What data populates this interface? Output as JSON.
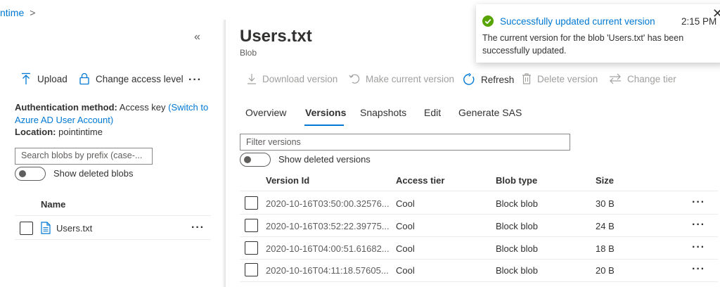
{
  "breadcrumb": {
    "text": "ntime",
    "separator": ">"
  },
  "left": {
    "collapse_glyph": "«",
    "upload_label": "Upload",
    "change_access_label": "Change access level",
    "more_glyph": "···",
    "auth_method_label": "Authentication method:",
    "auth_method_value": "Access key",
    "auth_switch_link": "(Switch to Azure AD User Account)",
    "location_label": "Location:",
    "location_value": "pointintime",
    "search_placeholder": "Search blobs by prefix (case-...",
    "show_deleted_label": "Show deleted blobs",
    "name_header": "Name",
    "files": [
      {
        "name": "Users.txt"
      }
    ]
  },
  "blob": {
    "title": "Users.txt",
    "subtitle": "Blob"
  },
  "toolbar": {
    "download": "Download version",
    "make_current": "Make current version",
    "refresh": "Refresh",
    "delete": "Delete version",
    "change_tier": "Change tier"
  },
  "tabs": [
    "Overview",
    "Versions",
    "Snapshots",
    "Edit",
    "Generate SAS"
  ],
  "active_tab": "Versions",
  "filter_placeholder": "Filter versions",
  "show_deleted_versions_label": "Show deleted versions",
  "table": {
    "headers": [
      "Version Id",
      "Access tier",
      "Blob type",
      "Size"
    ],
    "rows": [
      {
        "id": "2020-10-16T03:50:00.32576...",
        "tier": "Cool",
        "type": "Block blob",
        "size": "30 B"
      },
      {
        "id": "2020-10-16T03:52:22.39775...",
        "tier": "Cool",
        "type": "Block blob",
        "size": "24 B"
      },
      {
        "id": "2020-10-16T04:00:51.61682...",
        "tier": "Cool",
        "type": "Block blob",
        "size": "18 B"
      },
      {
        "id": "2020-10-16T04:11:18.57605...",
        "tier": "Cool",
        "type": "Block blob",
        "size": "20 B"
      }
    ]
  },
  "toast": {
    "title": "Successfully updated current version",
    "time": "2:15 PM",
    "message": "The current version for the blob 'Users.txt' has been successfully updated.",
    "close_glyph": "✕"
  },
  "colors": {
    "accent": "#0078d4",
    "success": "#57a300",
    "text": "#323130",
    "muted": "#a19f9d"
  }
}
